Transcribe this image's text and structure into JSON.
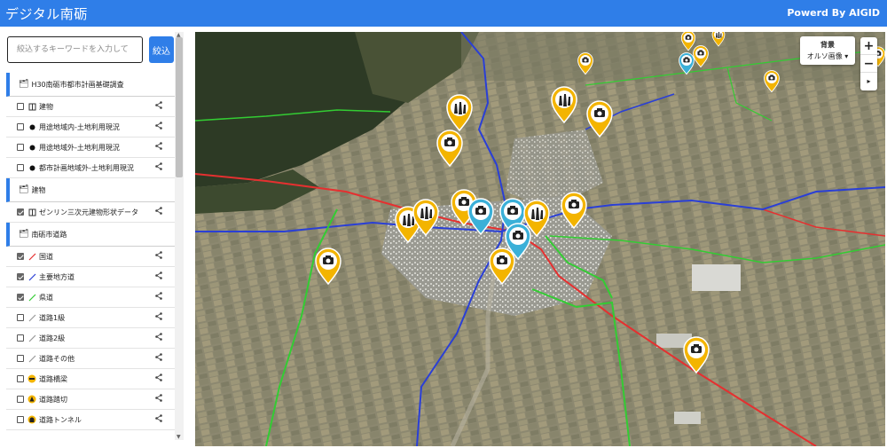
{
  "header": {
    "title": "デジタル南砺",
    "powered_by": "Powerd By AIGID",
    "color": "#2f7ee8"
  },
  "search": {
    "placeholder": "絞込するキーワードを入力して",
    "button_label": "絞込"
  },
  "layers": [
    {
      "group": "H30南砺市都市計画基礎調査",
      "items": [
        {
          "label": "建物",
          "checked": false,
          "symbol": "building-outline-icon"
        },
        {
          "label": "用途地域内-土地利用現況",
          "checked": false,
          "symbol": "black-dot-icon"
        },
        {
          "label": "用途地域外-土地利用現況",
          "checked": false,
          "symbol": "black-dot-icon"
        },
        {
          "label": "都市計画地域外-土地利用現況",
          "checked": false,
          "symbol": "black-dot-icon"
        }
      ]
    },
    {
      "group": "建物",
      "items": [
        {
          "label": "ゼンリン三次元建物形状データ",
          "checked": true,
          "symbol": "building-outline-icon"
        }
      ]
    },
    {
      "group": "南砺市道路",
      "items": [
        {
          "label": "国道",
          "checked": true,
          "symbol": "line-icon",
          "color": "#e53030"
        },
        {
          "label": "主要地方道",
          "checked": true,
          "symbol": "line-icon",
          "color": "#2a3fd6"
        },
        {
          "label": "県道",
          "checked": true,
          "symbol": "line-icon",
          "color": "#33cc33"
        },
        {
          "label": "道路1級",
          "checked": false,
          "symbol": "line-icon",
          "color": "#999999"
        },
        {
          "label": "道路2級",
          "checked": false,
          "symbol": "line-icon",
          "color": "#999999"
        },
        {
          "label": "道路その他",
          "checked": false,
          "symbol": "line-icon",
          "color": "#999999"
        },
        {
          "label": "道路橋梁",
          "checked": false,
          "symbol": "bridge-pin-icon"
        },
        {
          "label": "道路踏切",
          "checked": false,
          "symbol": "crossing-pin-icon"
        },
        {
          "label": "道路トンネル",
          "checked": false,
          "symbol": "tunnel-pin-icon"
        }
      ]
    }
  ],
  "map_controls": {
    "background_title": "背景",
    "background_value": "オルソ画像 ▾",
    "zoom_in": "+",
    "zoom_out": "−",
    "compass": "▸"
  },
  "colors": {
    "national_road": "#e53030",
    "major_road": "#2a3fd6",
    "prefectural_road": "#33cc33",
    "camera_pin": "#f3b400",
    "camera_pin_alt": "#3bb0d8"
  }
}
